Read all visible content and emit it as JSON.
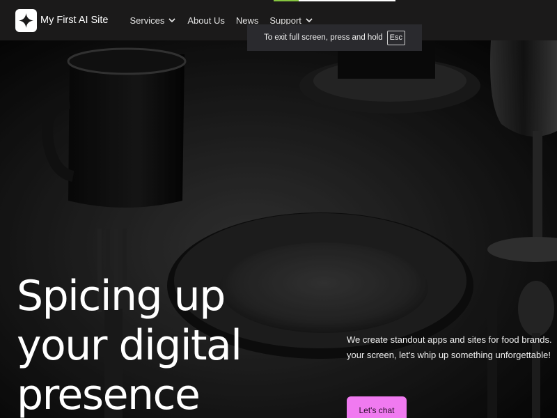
{
  "site": {
    "name": "My First AI Site"
  },
  "nav": {
    "items": [
      {
        "label": "Services",
        "has_dropdown": true
      },
      {
        "label": "About Us",
        "has_dropdown": false
      },
      {
        "label": "News",
        "has_dropdown": false
      },
      {
        "label": "Support",
        "has_dropdown": true
      }
    ]
  },
  "fullscreen_notice": {
    "text": "To exit full screen, press and hold",
    "key": "Esc"
  },
  "hero": {
    "headline": "Spicing up your digital presence",
    "subtext_line1": "We create standout apps and sites for food brands.",
    "subtext_line2": "your screen, let's whip up something unforgettable!",
    "cta_label": "Let's chat"
  },
  "colors": {
    "nav_background": "#1b1a1a",
    "cta_background": "#f07af0",
    "accent_green": "#86c540",
    "toast_background": "#2a2a2e"
  },
  "icons": {
    "logo": "sparkle-icon",
    "dropdown": "chevron-down-icon"
  }
}
